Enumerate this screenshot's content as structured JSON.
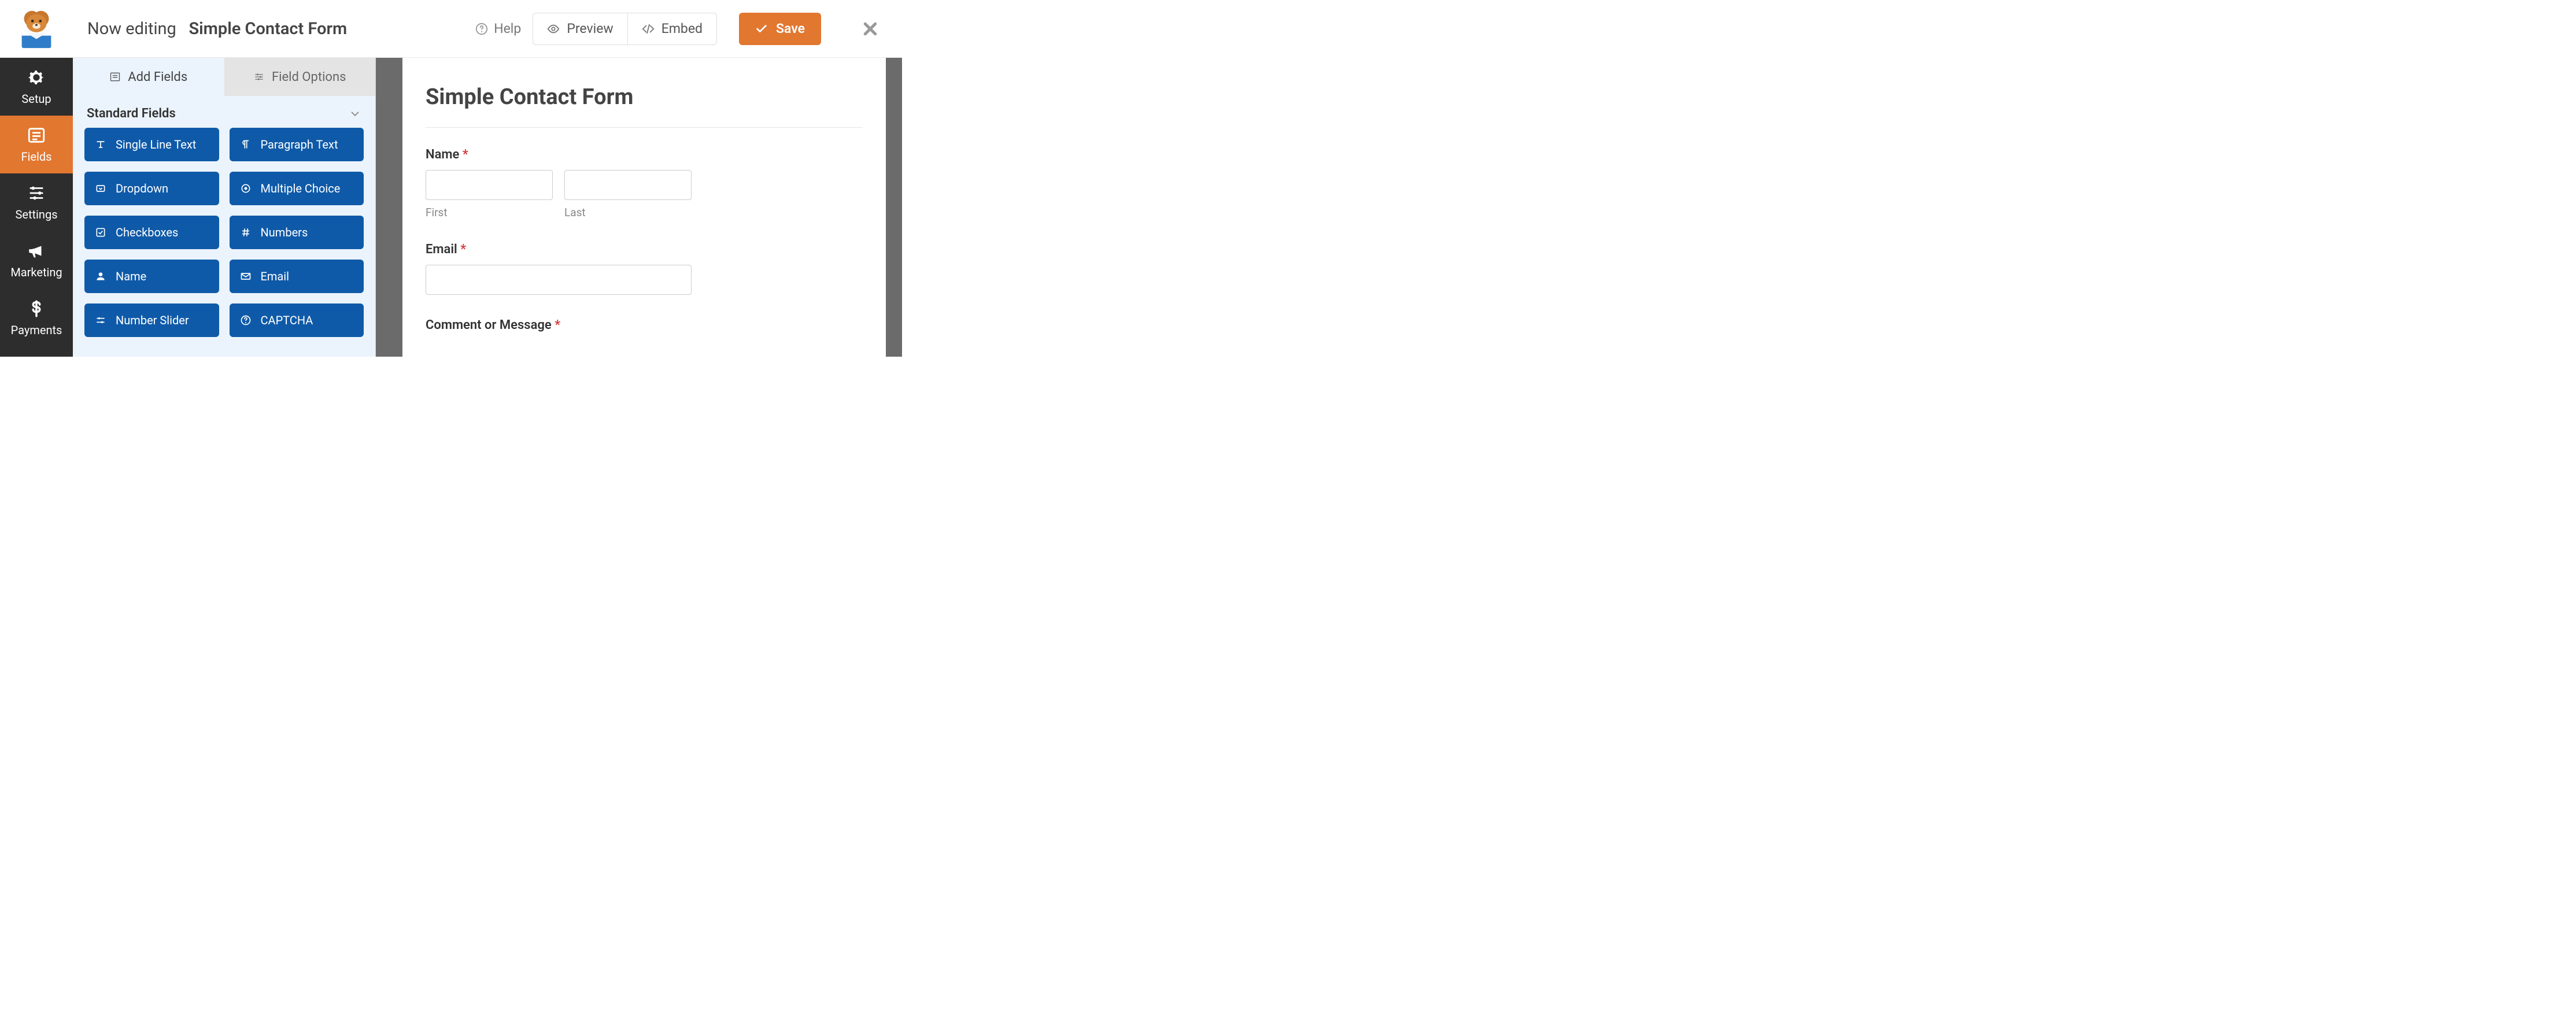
{
  "topbar": {
    "editing_prefix": "Now editing",
    "form_name": "Simple Contact Form",
    "help": "Help",
    "preview": "Preview",
    "embed": "Embed",
    "save": "Save"
  },
  "nav": {
    "setup": "Setup",
    "fields": "Fields",
    "settings": "Settings",
    "marketing": "Marketing",
    "payments": "Payments"
  },
  "panel": {
    "tab_add": "Add Fields",
    "tab_options": "Field Options",
    "section_title": "Standard Fields",
    "fields": [
      {
        "label": "Single Line Text"
      },
      {
        "label": "Paragraph Text"
      },
      {
        "label": "Dropdown"
      },
      {
        "label": "Multiple Choice"
      },
      {
        "label": "Checkboxes"
      },
      {
        "label": "Numbers"
      },
      {
        "label": "Name"
      },
      {
        "label": "Email"
      },
      {
        "label": "Number Slider"
      },
      {
        "label": "CAPTCHA"
      }
    ]
  },
  "form": {
    "title": "Simple Contact Form",
    "name_label": "Name",
    "first": "First",
    "last": "Last",
    "email_label": "Email",
    "comment_label": "Comment or Message",
    "required_mark": "*"
  }
}
